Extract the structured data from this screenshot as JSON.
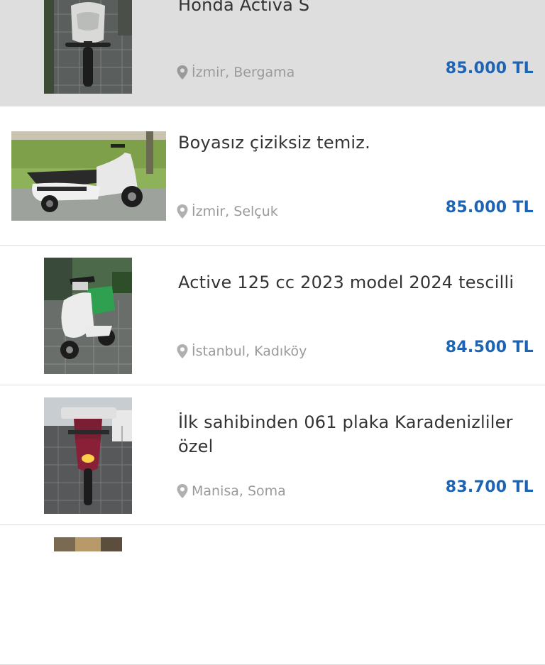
{
  "listings": [
    {
      "title": "Honda Activa S",
      "location": "İzmir, Bergama",
      "price": "85.000 TL",
      "highlighted": true
    },
    {
      "title": "Boyasız çiziksiz temiz.",
      "location": "İzmir, Selçuk",
      "price": "85.000 TL",
      "highlighted": false
    },
    {
      "title": "Active 125 cc 2023 model 2024 tescilli",
      "location": "İstanbul, Kadıköy",
      "price": "84.500 TL",
      "highlighted": false
    },
    {
      "title": "İlk sahibinden 061 plaka Karadenizliler özel",
      "location": "Manisa, Soma",
      "price": "83.700 TL",
      "highlighted": false
    }
  ],
  "icons": {
    "location": "map-pin-icon"
  },
  "colors": {
    "price": "#1e64b4",
    "location": "#9a9a9a",
    "highlight_bg": "#dedede",
    "divider": "#dcdcdc"
  }
}
